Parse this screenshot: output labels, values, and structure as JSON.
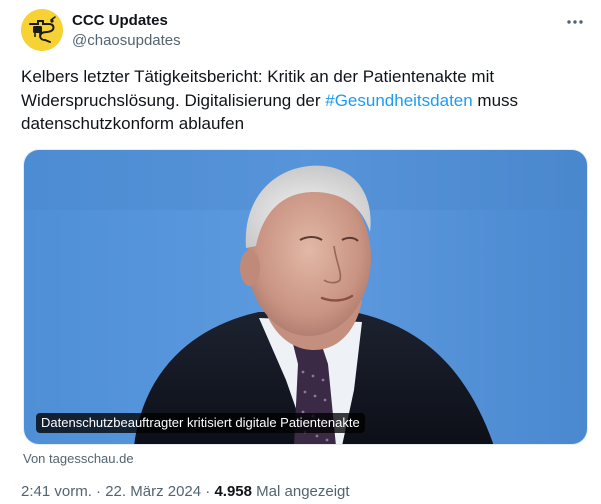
{
  "author": {
    "display_name": "CCC Updates",
    "handle": "@chaosupdates",
    "avatar_icon": "chaos-knoten-logo-icon",
    "avatar_color": "#f7d234"
  },
  "menu": {
    "more_icon": "more-horizontal-icon"
  },
  "tweet": {
    "text_before": "Kelbers letzter Tätigkeitsbericht: Kritik an der Patientenakte mit Widerspruchslösung. Digitalisierung der ",
    "hashtag": "#Gesundheitsdaten",
    "text_after": " muss datenschutzkonform ablaufen"
  },
  "card": {
    "title": "Datenschutzbeauftragter kritisiert digitale Patientenakte",
    "source": "Von tagesschau.de"
  },
  "meta": {
    "time": "2:41 vorm.",
    "separator1": " · ",
    "date": "22. März 2024",
    "separator2": " · ",
    "views_count": "4.958",
    "views_label": " Mal angezeigt"
  },
  "colors": {
    "accent": "#1d9bf0",
    "secondary_text": "#536471",
    "primary_text": "#0f1419"
  }
}
